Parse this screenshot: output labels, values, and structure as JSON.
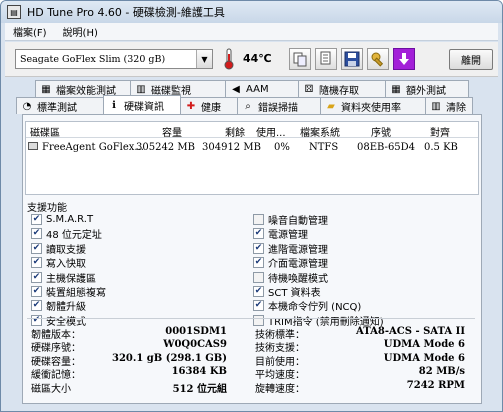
{
  "window": {
    "title": "HD Tune Pro 4.60 - 硬碟檢測-維護工具"
  },
  "menu": {
    "items": [
      "檔案(F)",
      "說明(H)"
    ]
  },
  "toolbar": {
    "drive": "Seagate GoFlex Slim      (320 gB)",
    "temperature": "44℃",
    "exit_label": "離開"
  },
  "tabs_top": [
    "檔案效能測試",
    "磁碟監視",
    "AAM",
    "隨機存取",
    "額外測試"
  ],
  "tabs_bottom": [
    "標準測試",
    "硬碟資訊",
    "健康",
    "錯誤掃描",
    "資料夾使用率",
    "清除"
  ],
  "partition_table": {
    "headers": [
      "磁碟區",
      "容量",
      "剩餘",
      "使用...",
      "檔案系統",
      "序號",
      "對齊"
    ],
    "rows": [
      [
        "FreeAgent GoFlex...",
        "305242 MB",
        "304912 MB",
        "0%",
        "NTFS",
        "08EB-65D4",
        "0.5 KB"
      ]
    ]
  },
  "features": {
    "label": "支援功能",
    "left": [
      {
        "label": "S.M.A.R.T",
        "checked": true
      },
      {
        "label": "48 位元定址",
        "checked": true
      },
      {
        "label": "讀取支援",
        "checked": true
      },
      {
        "label": "寫入快取",
        "checked": true
      },
      {
        "label": "主機保護區",
        "checked": true
      },
      {
        "label": "裝置組態複寫",
        "checked": true
      },
      {
        "label": "韌體升級",
        "checked": true
      },
      {
        "label": "安全模式",
        "checked": true
      }
    ],
    "right": [
      {
        "label": "噪音自動管理",
        "checked": false
      },
      {
        "label": "電源管理",
        "checked": true
      },
      {
        "label": "進階電源管理",
        "checked": true
      },
      {
        "label": "介面電源管理",
        "checked": true
      },
      {
        "label": "待機喚醒模式",
        "checked": false
      },
      {
        "label": "SCT 資料表",
        "checked": true
      },
      {
        "label": "本機命令佇列 (NCQ)",
        "checked": true
      },
      {
        "label": "TRIM指令 (禁用刪除通知)",
        "checked": false
      }
    ]
  },
  "info": {
    "left": [
      {
        "label": "韌體版本：",
        "value": "0001SDM1"
      },
      {
        "label": "硬碟序號：",
        "value": "W0Q0CAS9"
      },
      {
        "label": "硬碟容量：",
        "value": "320.1 gB (298.1 GB)"
      },
      {
        "label": "緩衝記憶：",
        "value": "16384 KB"
      },
      {
        "label": "磁區大小",
        "value": "512 位元組"
      }
    ],
    "right": [
      {
        "label": "技術標準：",
        "value": "ATA8-ACS - SATA II"
      },
      {
        "label": "技術支援：",
        "value": "UDMA Mode 6"
      },
      {
        "label": "目前使用：",
        "value": "UDMA Mode 6"
      },
      {
        "label": "平均速度：",
        "value": "82 MB/s"
      },
      {
        "label": "旋轉速度：",
        "value": "7242 RPM"
      }
    ]
  },
  "colors": {
    "titlebar": "#c8d7e8",
    "tab_active": "#ffffff",
    "exit_button_purple": "#a31fd8",
    "thermometer_red": "#d21c1c"
  }
}
